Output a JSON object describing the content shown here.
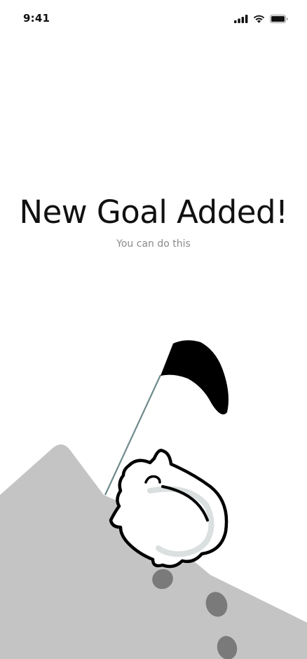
{
  "status_bar": {
    "time": "9:41",
    "icons": [
      "signal-icon",
      "wifi-icon",
      "battery-icon"
    ]
  },
  "content": {
    "title": "New Goal Added!",
    "subtitle": "You can do this"
  },
  "illustration": {
    "elements": [
      "mountain",
      "goal-flag",
      "character",
      "footprints"
    ]
  },
  "colors": {
    "background": "#ffffff",
    "mountain": "#c4c4c4",
    "footprint": "#7a7a7a",
    "flag": "#000000",
    "flag_pole": "#6f8a8c",
    "character_fill": "#ffffff",
    "character_outline": "#000000",
    "character_shadow": "#d6dcdc",
    "subtitle_text": "#8a8a8a"
  }
}
